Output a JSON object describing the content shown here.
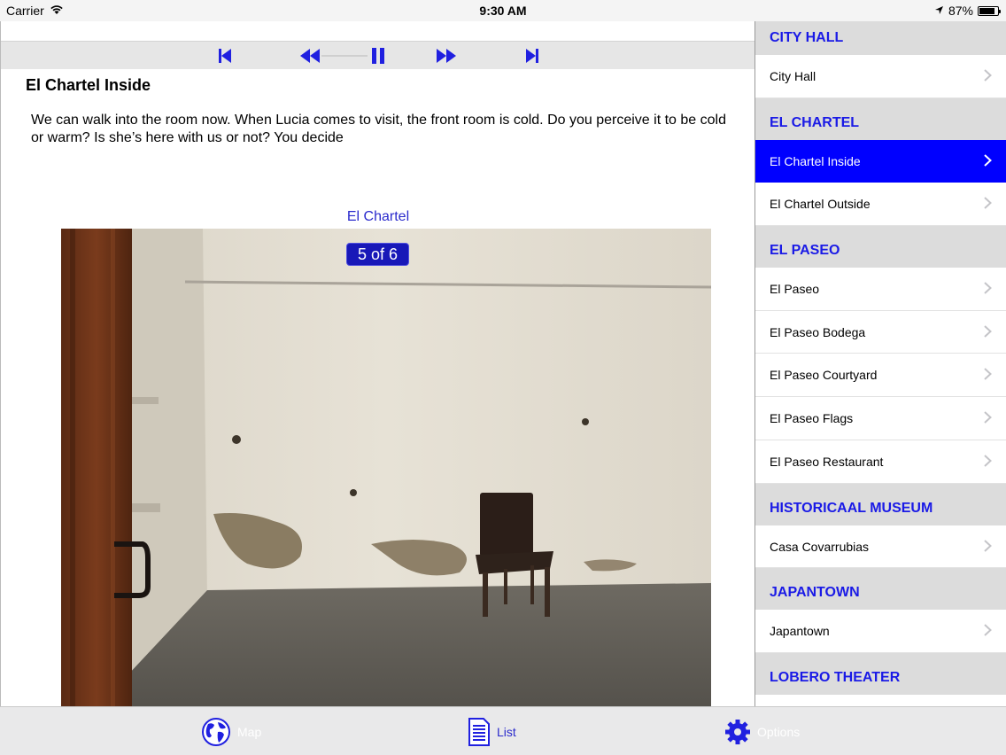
{
  "status_bar": {
    "carrier": "Carrier",
    "time": "9:30 AM",
    "battery_percent": "87%",
    "battery_level": 0.87
  },
  "player": {
    "buttons": [
      "skip-back-icon",
      "rewind-icon",
      "pause-icon",
      "fast-forward-icon",
      "skip-forward-icon"
    ],
    "accent_color": "#2020e0"
  },
  "content": {
    "title": "El Chartel Inside",
    "description": "We can walk into the room now. When Lucia comes to visit, the front room is cold. Do you perceive it to be cold or warm? Is she’s here with us or not?  You decide",
    "image_caption": "El Chartel",
    "image_counter": "5 of 6"
  },
  "sidebar": {
    "sections": [
      {
        "header": "CITY HALL",
        "items": [
          {
            "label": "City Hall"
          }
        ]
      },
      {
        "header": "EL CHARTEL",
        "items": [
          {
            "label": "El Chartel Inside",
            "selected": true
          },
          {
            "label": "El Chartel Outside"
          }
        ]
      },
      {
        "header": "EL PASEO",
        "items": [
          {
            "label": "El Paseo"
          },
          {
            "label": "El Paseo Bodega"
          },
          {
            "label": "El Paseo Courtyard"
          },
          {
            "label": "El Paseo Flags"
          },
          {
            "label": "El Paseo Restaurant"
          }
        ]
      },
      {
        "header": "HISTORICAAL MUSEUM",
        "items": [
          {
            "label": "Casa Covarrubias"
          }
        ]
      },
      {
        "header": "JAPANTOWN",
        "items": [
          {
            "label": "Japantown"
          }
        ]
      },
      {
        "header": "LOBERO THEATER",
        "items": []
      }
    ],
    "selected_color": "#0000ff",
    "header_color": "#1a1ae6"
  },
  "tabbar": {
    "tabs": [
      {
        "label": "Map",
        "icon": "globe-icon"
      },
      {
        "label": "List",
        "icon": "document-list-icon",
        "active": true
      },
      {
        "label": "Options",
        "icon": "gear-icon"
      }
    ]
  }
}
